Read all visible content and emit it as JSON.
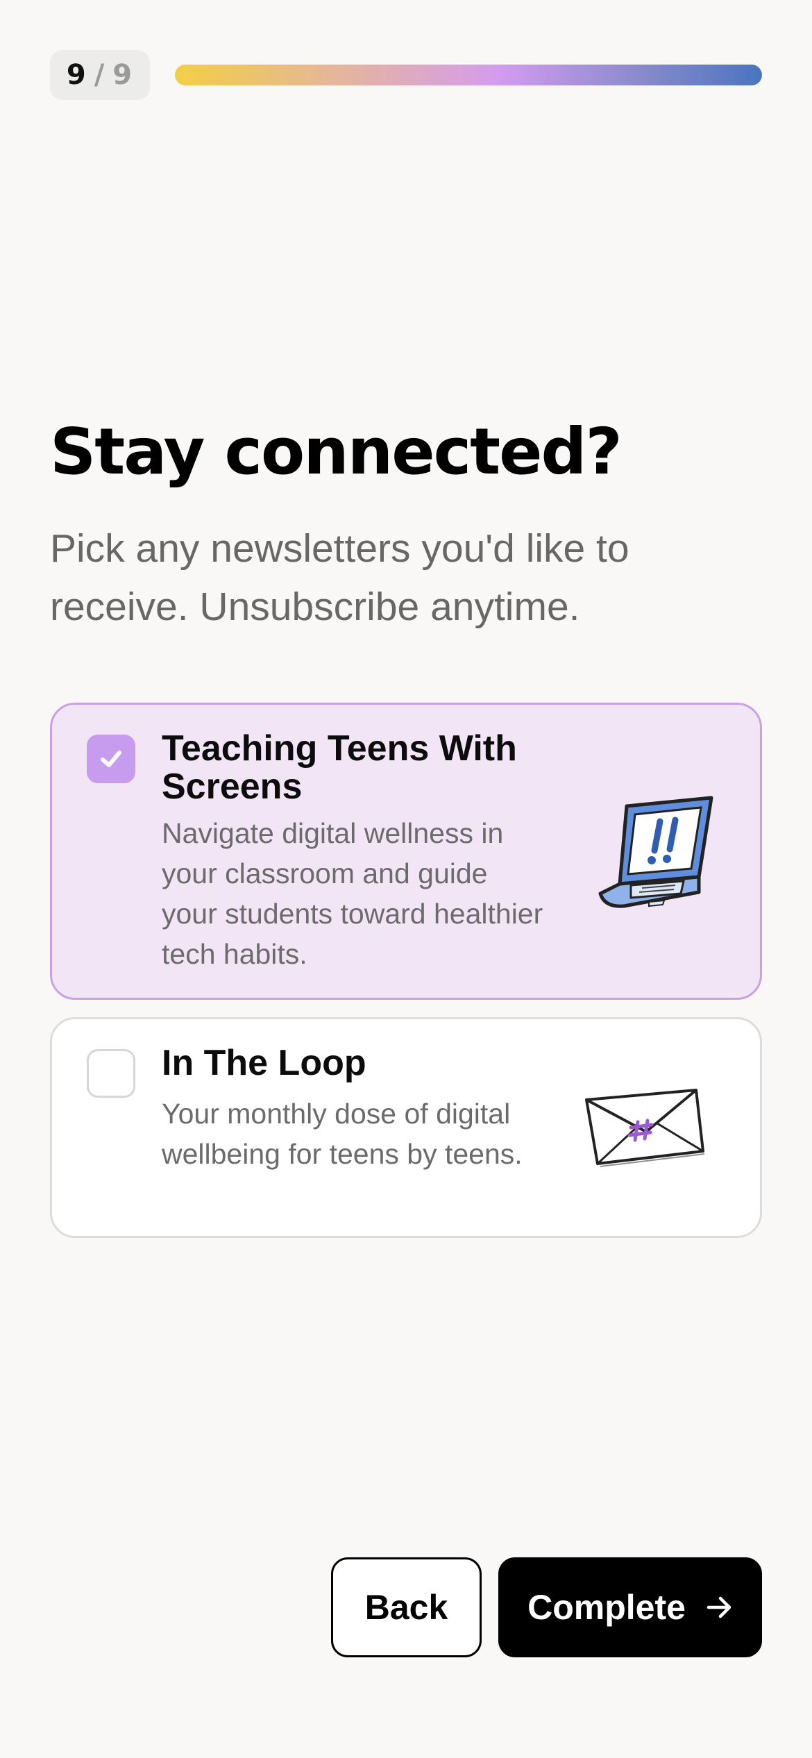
{
  "progress": {
    "current": "9",
    "separator": "/",
    "total": "9",
    "fraction": 1.0
  },
  "heading": {
    "title": "Stay connected?",
    "subtitle": "Pick any newsletters you'd like to receive. Unsubscribe anytime."
  },
  "newsletters": [
    {
      "title": "Teaching Teens With Screens",
      "description": "Navigate digital wellness in your classroom and guide your students toward healthier tech habits.",
      "checked": true,
      "icon": "laptop-alert-icon"
    },
    {
      "title": "In The Loop",
      "description": "Your monthly dose of digital wellbeing for teens by teens.",
      "checked": false,
      "icon": "envelope-hashtag-icon"
    }
  ],
  "footer": {
    "back_label": "Back",
    "complete_label": "Complete"
  },
  "colors": {
    "accent": "#c79bee",
    "selected_bg": "#f2e6f6",
    "primary": "#000000"
  }
}
